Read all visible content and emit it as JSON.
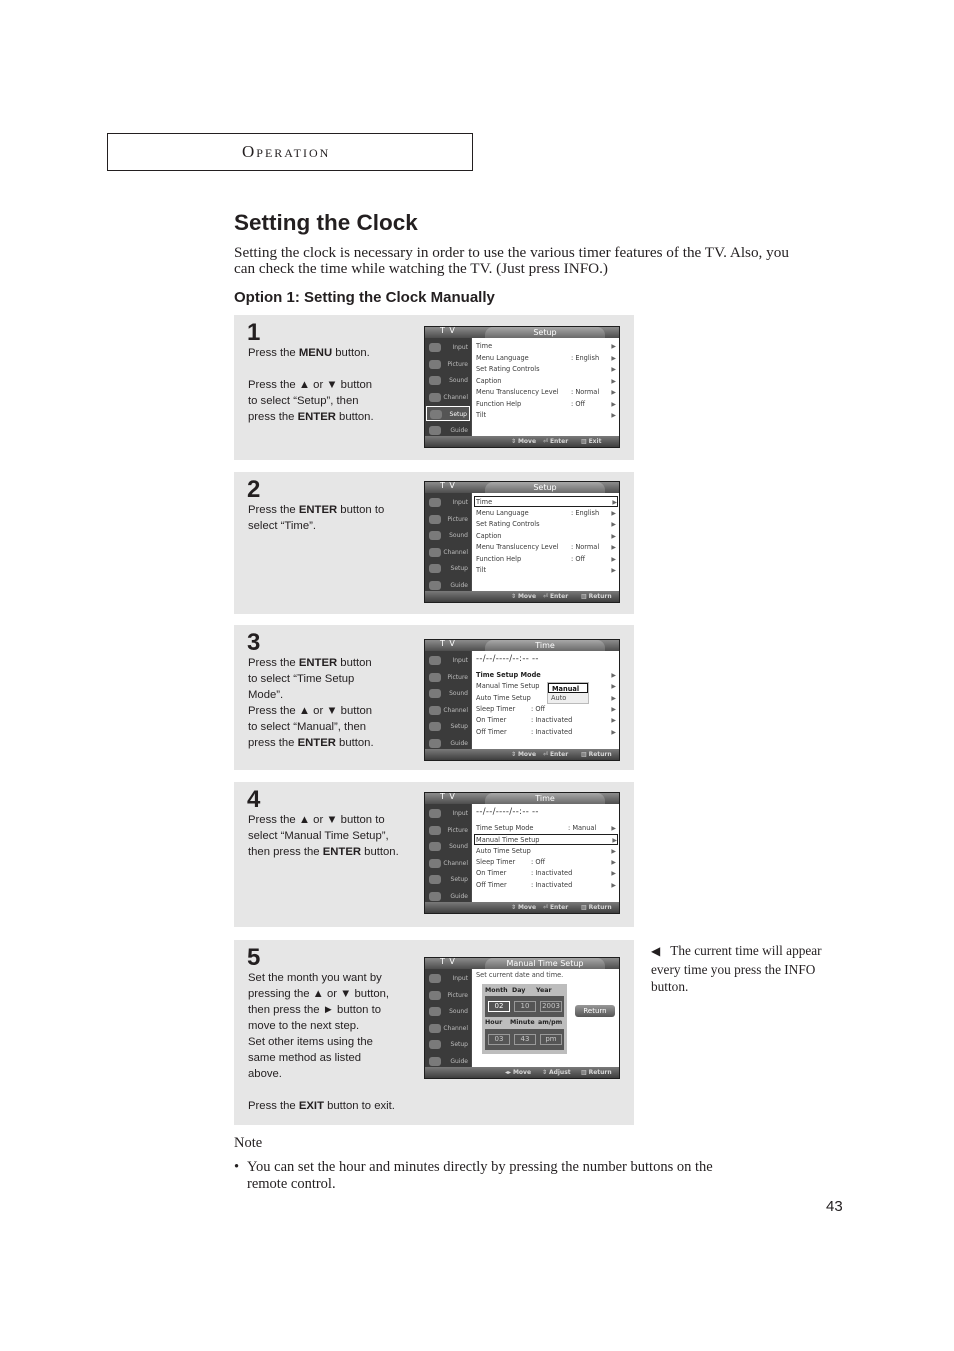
{
  "section": "Operation",
  "title": "Setting the Clock",
  "intro": "Setting the clock is necessary in order to use the various timer features of the TV. Also, you can check the time while watching the TV. (Just press INFO.)",
  "subtitle": "Option 1: Setting the Clock Manually",
  "tv_common": {
    "label": "T V",
    "sidebar": [
      "Input",
      "Picture",
      "Sound",
      "Channel",
      "Setup",
      "Guide"
    ],
    "footer_move": "Move",
    "footer_enter": "Enter",
    "footer_exit": "Exit",
    "footer_return": "Return",
    "footer_adjust": "Adjust"
  },
  "steps": [
    {
      "number": "1",
      "text_html": "Press the <b>MENU</b> button.\n\nPress the ▲ or ▼ button\nto select “Setup”, then\npress the <b>ENTER</b> button.",
      "screen": {
        "title": "Setup",
        "rows": [
          {
            "label": "Time",
            "value": ""
          },
          {
            "label": "Menu Language",
            "value": ": English"
          },
          {
            "label": "Set Rating Controls",
            "value": ""
          },
          {
            "label": "Caption",
            "value": ""
          },
          {
            "label": "Menu Translucency Level",
            "value": ": Normal"
          },
          {
            "label": "Function Help",
            "value": ": Off"
          },
          {
            "label": "Tilt",
            "value": ""
          }
        ]
      }
    },
    {
      "number": "2",
      "text_html": "Press the <b>ENTER</b> button to\nselect “Time”.",
      "screen": {
        "title": "Setup",
        "rows": [
          {
            "label": "Time",
            "value": ""
          },
          {
            "label": "Menu Language",
            "value": ": English"
          },
          {
            "label": "Set Rating Controls",
            "value": ""
          },
          {
            "label": "Caption",
            "value": ""
          },
          {
            "label": "Menu Translucency Level",
            "value": ": Normal"
          },
          {
            "label": "Function Help",
            "value": ": Off"
          },
          {
            "label": "Tilt",
            "value": ""
          }
        ]
      }
    },
    {
      "number": "3",
      "text_html": "Press the <b>ENTER</b> button\nto select “Time Setup\nMode”.\nPress the ▲ or ▼ button\nto select “Manual”, then\npress the <b>ENTER</b> button.",
      "screen": {
        "title": "Time",
        "clock": "--/--/----/--:-- --",
        "rows": [
          {
            "label": "Time Setup Mode",
            "value": ""
          },
          {
            "label": "Manual Time Setup",
            "value": ""
          },
          {
            "label": "Auto Time Setup",
            "value": ""
          },
          {
            "label": "Sleep Timer",
            "value": ": Off"
          },
          {
            "label": "On Timer",
            "value": ": Inactivated"
          },
          {
            "label": "Off Timer",
            "value": ": Inactivated"
          }
        ],
        "dropdown": [
          "Manual",
          "Auto"
        ]
      }
    },
    {
      "number": "4",
      "text_html": "Press the ▲ or ▼ button to\nselect “Manual Time Setup”,\nthen press the <b>ENTER</b> button.",
      "screen": {
        "title": "Time",
        "clock": "--/--/----/--:-- --",
        "rows": [
          {
            "label": "Time Setup Mode",
            "value": ": Manual"
          },
          {
            "label": "Manual Time Setup",
            "value": ""
          },
          {
            "label": "Auto Time Setup",
            "value": ""
          },
          {
            "label": "Sleep Timer",
            "value": ": Off"
          },
          {
            "label": "On Timer",
            "value": ": Inactivated"
          },
          {
            "label": "Off Timer",
            "value": ": Inactivated"
          }
        ]
      }
    },
    {
      "number": "5",
      "text_html": "Set the month you want by\npressing the ▲ or ▼ button,\nthen press the ► button to\nmove to the next step.\nSet other items using the\nsame method as listed\nabove.\n\nPress the <b>EXIT</b> button to exit.",
      "screen": {
        "title": "Manual Time Setup",
        "desc": "Set current date and time.",
        "date_headers": [
          "Month",
          "Day",
          "Year"
        ],
        "date_values": [
          "02",
          "10",
          "2003"
        ],
        "time_headers": [
          "Hour",
          "Minute",
          "am/pm"
        ],
        "time_values": [
          "03",
          "43",
          "pm"
        ],
        "return_button": "Return"
      }
    }
  ],
  "side_note": "The current time will appear every time you press the INFO button.",
  "note_label": "Note",
  "note_items": [
    "You can set the hour and minutes directly by pressing the number buttons on the remote control."
  ],
  "page_number": "43"
}
